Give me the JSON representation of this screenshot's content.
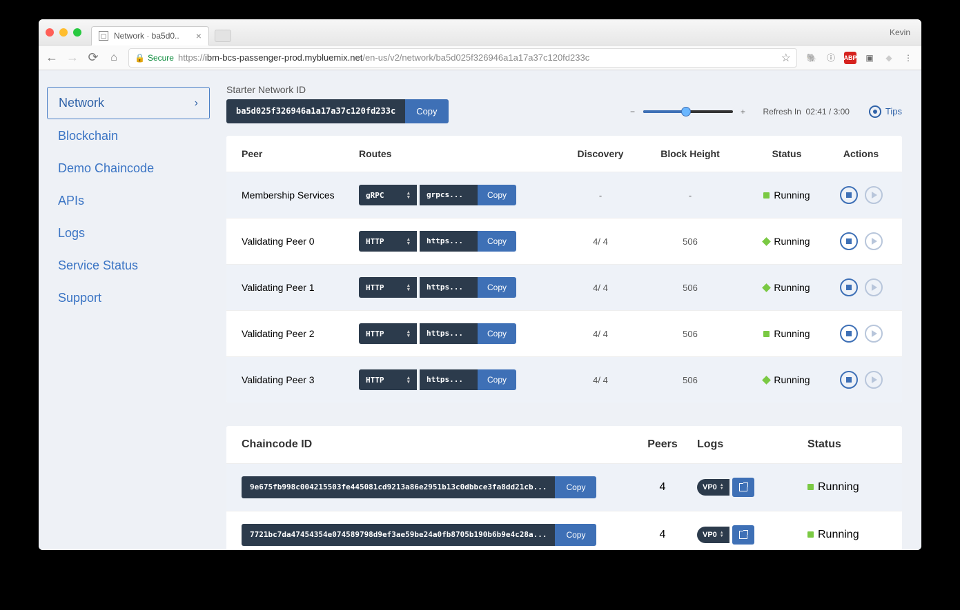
{
  "browser": {
    "tab_title": "Network · ba5d0..",
    "profile": "Kevin",
    "secure_label": "Secure",
    "url_scheme": "https://",
    "url_host": "ibm-bcs-passenger-prod.mybluemix.net",
    "url_path": "/en-us/v2/network/ba5d025f326946a1a17a37c120fd233c"
  },
  "labels": {
    "copy": "Copy",
    "tips": "Tips"
  },
  "sidebar": {
    "items": [
      "Network",
      "Blockchain",
      "Demo Chaincode",
      "APIs",
      "Logs",
      "Service Status",
      "Support"
    ]
  },
  "network": {
    "id_label": "Starter Network ID",
    "id": "ba5d025f326946a1a17a37c120fd233c",
    "refresh_label": "Refresh In",
    "refresh_value": "02:41 / 3:00"
  },
  "peers": {
    "headers": {
      "peer": "Peer",
      "routes": "Routes",
      "discovery": "Discovery",
      "block_height": "Block Height",
      "status": "Status",
      "actions": "Actions"
    },
    "rows": [
      {
        "name": "Membership Services",
        "protocol": "gRPC",
        "route": "grpcs...",
        "discovery": "-",
        "block_height": "-",
        "status": "Running"
      },
      {
        "name": "Validating Peer 0",
        "protocol": "HTTP",
        "route": "https...",
        "discovery": "4/ 4",
        "block_height": "506",
        "status": "Running"
      },
      {
        "name": "Validating Peer 1",
        "protocol": "HTTP",
        "route": "https...",
        "discovery": "4/ 4",
        "block_height": "506",
        "status": "Running"
      },
      {
        "name": "Validating Peer 2",
        "protocol": "HTTP",
        "route": "https...",
        "discovery": "4/ 4",
        "block_height": "506",
        "status": "Running"
      },
      {
        "name": "Validating Peer 3",
        "protocol": "HTTP",
        "route": "https...",
        "discovery": "4/ 4",
        "block_height": "506",
        "status": "Running"
      }
    ]
  },
  "chaincode": {
    "headers": {
      "id": "Chaincode ID",
      "peers": "Peers",
      "logs": "Logs",
      "status": "Status"
    },
    "rows": [
      {
        "id": "9e675fb998c004215503fe445081cd9213a86e2951b13c0dbbce3fa8dd21cb...",
        "peers": "4",
        "log_peer": "VP0",
        "status": "Running"
      },
      {
        "id": "7721bc7da47454354e074589798d9ef3ae59be24a0fb8705b190b6b9e4c28a...",
        "peers": "4",
        "log_peer": "VP0",
        "status": "Running"
      }
    ]
  }
}
